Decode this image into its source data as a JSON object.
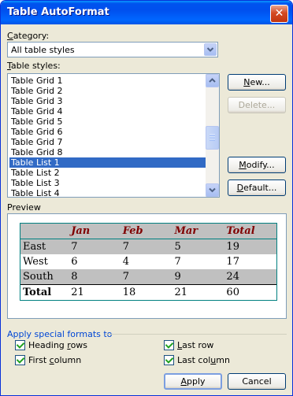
{
  "window": {
    "title": "Table AutoFormat",
    "close_glyph": "✕"
  },
  "category": {
    "label_accel": "C",
    "label_rest": "ategory:",
    "value": "All table styles"
  },
  "styles": {
    "label_accel": "T",
    "label_rest": "able styles:",
    "items": [
      "Table Grid 1",
      "Table Grid 2",
      "Table Grid 3",
      "Table Grid 4",
      "Table Grid 5",
      "Table Grid 6",
      "Table Grid 7",
      "Table Grid 8",
      "Table List 1",
      "Table List 2",
      "Table List 3",
      "Table List 4"
    ],
    "selected": "Table List 1"
  },
  "buttons": {
    "new_accel": "N",
    "new_rest": "ew...",
    "delete_label": "Delete...",
    "modify_accel": "M",
    "modify_rest": "odify...",
    "default_accel": "D",
    "default_rest": "efault...",
    "apply_accel": "A",
    "apply_rest": "pply",
    "cancel_label": "Cancel"
  },
  "preview": {
    "label": "Preview",
    "header": [
      "",
      "Jan",
      "Feb",
      "Mar",
      "Total"
    ],
    "rows": [
      [
        "East",
        "7",
        "7",
        "5",
        "19"
      ],
      [
        "West",
        "6",
        "4",
        "7",
        "17"
      ],
      [
        "South",
        "8",
        "7",
        "9",
        "24"
      ]
    ],
    "total_row": [
      "Total",
      "21",
      "18",
      "21",
      "60"
    ],
    "colors": {
      "header_text": "#800000",
      "gray_row": "#C0C0C0",
      "border": "#008080"
    }
  },
  "special": {
    "label": "Apply special formats to",
    "heading_rows_pre": "Heading ",
    "heading_rows_accel": "r",
    "heading_rows_post": "ows",
    "first_column_pre": "First ",
    "first_column_accel": "c",
    "first_column_post": "olumn",
    "last_row_pre": "",
    "last_row_accel": "L",
    "last_row_post": "ast row",
    "last_column_pre": "Last col",
    "last_column_accel": "u",
    "last_column_post": "mn"
  }
}
